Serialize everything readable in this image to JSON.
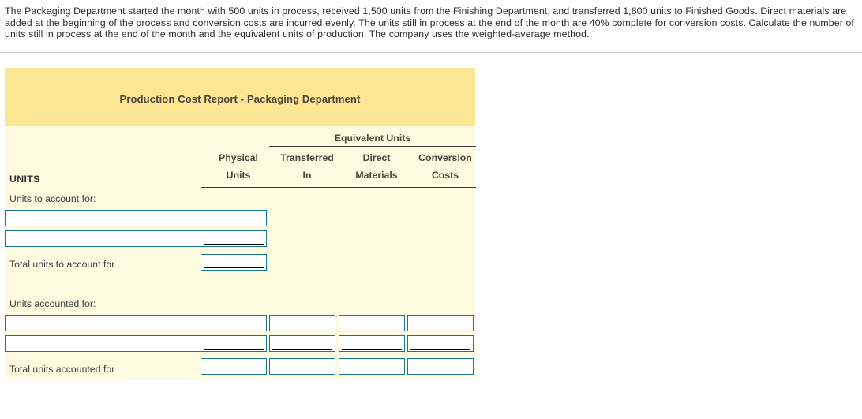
{
  "problem": {
    "text": "The Packaging Department started the month with 500 units in process, received 1,500 units from the Finishing Department, and transferred 1,800 units to Finished Goods. Direct materials are added at the beginning of the process and conversion costs are incurred evenly. The units still in process at the end of the month are 40% complete for conversion costs. Calculate the number of units still in process at the end of the month and the equivalent units of production. The company uses the weighted-average method."
  },
  "report": {
    "title": "Production Cost Report - Packaging Department",
    "group_header": "Equivalent Units",
    "columns": [
      {
        "line1": "Physical",
        "line2": "Units"
      },
      {
        "line1": "Transferred",
        "line2": "In"
      },
      {
        "line1": "Direct",
        "line2": "Materials"
      },
      {
        "line1": "Conversion",
        "line2": "Costs"
      }
    ],
    "section_label": "UNITS",
    "labels": {
      "units_to_account_for": "Units to account for:",
      "total_units_to_account_for": "Total units to account for",
      "units_accounted_for": "Units accounted for:",
      "total_units_accounted_for": "Total units accounted for"
    },
    "inputs": {
      "to_account_desc_1": "",
      "to_account_desc_2": "",
      "to_account_phys_1": "",
      "to_account_phys_2": "",
      "total_to_account_phys": "",
      "accounted_desc_1": "",
      "accounted_desc_2": "",
      "accounted_r1_phys": "",
      "accounted_r1_ti": "",
      "accounted_r1_dm": "",
      "accounted_r1_cc": "",
      "accounted_r2_phys": "",
      "accounted_r2_ti": "",
      "accounted_r2_dm": "",
      "accounted_r2_cc": "",
      "total_accounted_phys": "",
      "total_accounted_ti": "",
      "total_accounted_dm": "",
      "total_accounted_cc": ""
    }
  },
  "colors": {
    "panel_header": "#fce693",
    "panel_body": "#fdfce1",
    "input_border": "#16788a"
  }
}
